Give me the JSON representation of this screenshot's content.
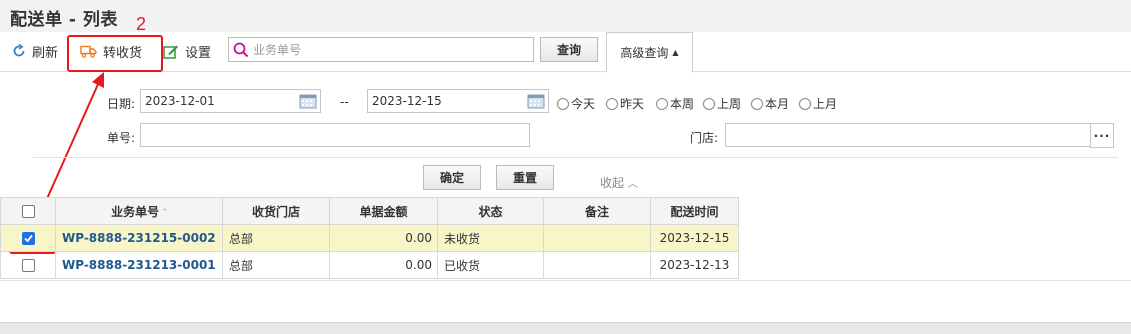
{
  "page": {
    "title": "配送单 - 列表"
  },
  "toolbar": {
    "refresh_label": "刷新",
    "receive_label": "转收货",
    "settings_label": "设置",
    "search_placeholder": "业务单号",
    "query_label": "查询",
    "advanced_label": "高级查询"
  },
  "annotation": {
    "step_number": "2",
    "color": "#e8191d"
  },
  "filter": {
    "date_label": "日期:",
    "date_from": "2023-12-01",
    "date_separator": "--",
    "date_to": "2023-12-15",
    "presets": [
      "今天",
      "昨天",
      "本周",
      "上周",
      "本月",
      "上月"
    ],
    "number_label": "单号:",
    "number_value": "",
    "store_label": "门店:",
    "store_value": "",
    "confirm_label": "确定",
    "reset_label": "重置",
    "collapse_label": "收起"
  },
  "table": {
    "columns": [
      "业务单号",
      "收货门店",
      "单据金额",
      "状态",
      "备注",
      "配送时间"
    ],
    "rows": [
      {
        "checked": true,
        "doc_no": "WP-8888-231215-0002",
        "store": "总部",
        "amount": "0.00",
        "status": "未收货",
        "remark": "",
        "time": "2023-12-15"
      },
      {
        "checked": false,
        "doc_no": "WP-8888-231213-0001",
        "store": "总部",
        "amount": "0.00",
        "status": "已收货",
        "remark": "",
        "time": "2023-12-13"
      }
    ]
  },
  "colors": {
    "link": "#20588f",
    "selected_row": "#f8f5c8",
    "accent_red": "#e8191d",
    "checkbox_blue": "#1e72e6"
  }
}
